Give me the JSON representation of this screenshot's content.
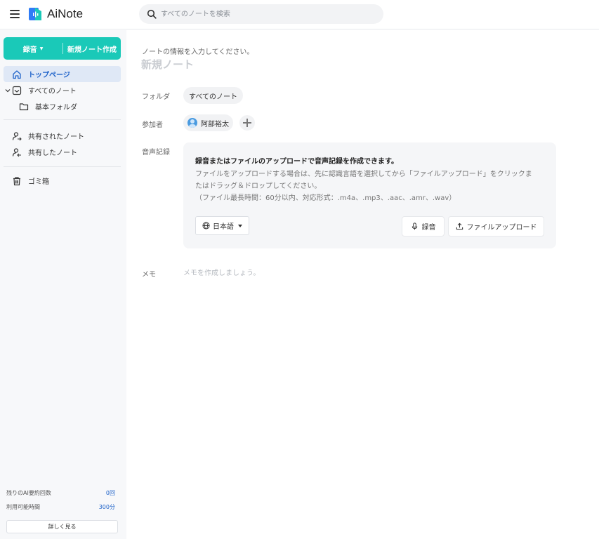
{
  "header": {
    "app_title": "AiNote",
    "search_placeholder": "すべてのノートを検索",
    "icons": [
      "menu-icon",
      "logo-icon",
      "search-icon"
    ]
  },
  "sidebar": {
    "record_button": "録音",
    "new_note_button": "新規ノート作成",
    "items": [
      {
        "label": "トップページ",
        "icon": "home-icon",
        "active": true
      },
      {
        "label": "すべてのノート",
        "icon": "inbox-icon",
        "expanded": true
      },
      {
        "label": "基本フォルダ",
        "icon": "folder-icon"
      },
      {
        "label": "共有されたノート",
        "icon": "shared-user-icon"
      },
      {
        "label": "共有したノート",
        "icon": "share-user-icon"
      },
      {
        "label": "ゴミ箱",
        "icon": "trash-icon"
      }
    ],
    "quota": [
      {
        "label": "残りのAI要約回数",
        "value": "0回"
      },
      {
        "label": "利用可能時間",
        "value": "300分"
      }
    ],
    "details_button": "詳しく見る"
  },
  "main": {
    "hint": "ノートの情報を入力してください。",
    "title_placeholder": "新規ノート",
    "folder_label": "フォルダ",
    "folder_value": "すべてのノート",
    "participants_label": "参加者",
    "participant_name": "阿部裕太",
    "audio_label": "音声記録",
    "audio_heading": "録音またはファイルのアップロードで音声記録を作成できます。",
    "audio_desc_1": "ファイルをアップロードする場合は、先に認識言語を選択してから「ファイルアップロード」をクリックま",
    "audio_desc_2": "たはドラッグ＆ドロップしてください。",
    "audio_desc_3": "（ファイル最長時間：60分以内、対応形式：.m4a、.mp3、.aac、.amr、.wav）",
    "language": "日本語",
    "record_button": "録音",
    "upload_button": "ファイルアップロード",
    "memo_label": "メモ",
    "memo_placeholder": "メモを作成しましょう。"
  },
  "colors": {
    "accent": "#1ac9b8",
    "active_nav_bg": "#dfe8f6",
    "active_nav_text": "#1e62c9",
    "sidebar_bg": "#f7f8fa"
  }
}
